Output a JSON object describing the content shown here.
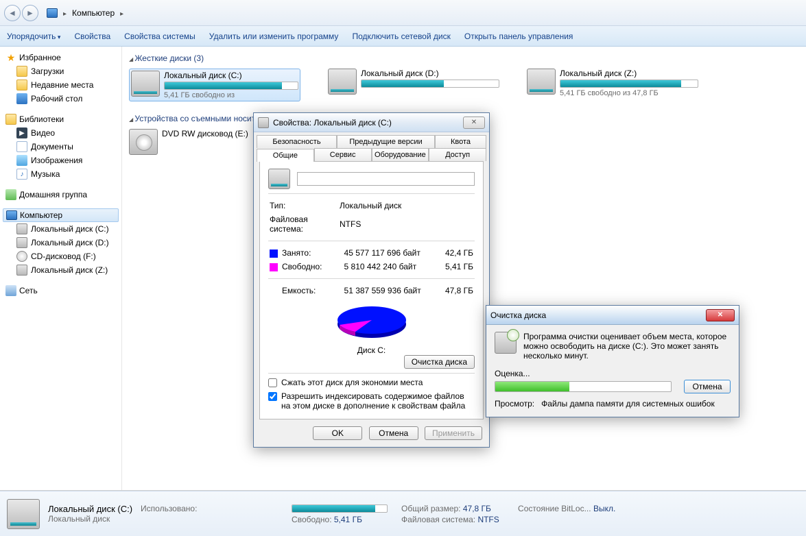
{
  "breadcrumb": {
    "root_icon": "computer",
    "item1": "Компьютер"
  },
  "toolbar": {
    "organize": "Упорядочить",
    "properties": "Свойства",
    "sysprops": "Свойства системы",
    "uninstall": "Удалить или изменить программу",
    "mapdrive": "Подключить сетевой диск",
    "controlpanel": "Открыть панель управления"
  },
  "sidebar": {
    "favorites": "Избранное",
    "downloads": "Загрузки",
    "recent": "Недавние места",
    "desktop": "Рабочий стол",
    "libraries": "Библиотеки",
    "video": "Видео",
    "documents": "Документы",
    "pictures": "Изображения",
    "music": "Музыка",
    "homegroup": "Домашняя группа",
    "computer": "Компьютер",
    "drive_c": "Локальный диск (C:)",
    "drive_d": "Локальный диск (D:)",
    "drive_f": "CD-дисковод (F:)",
    "drive_z": "Локальный диск (Z:)",
    "network": "Сеть"
  },
  "content": {
    "hd_header": "Жесткие диски (3)",
    "removable_header": "Устройства со съемными носителями",
    "drive_c": {
      "name": "Локальный диск (C:)",
      "sub": "5,41 ГБ свободно из",
      "fill": 88
    },
    "drive_d": {
      "name": "Локальный диск (D:)",
      "sub": "",
      "fill": 60
    },
    "drive_z": {
      "name": "Локальный диск (Z:)",
      "sub": "5,41 ГБ свободно из 47,8 ГБ",
      "fill": 88
    },
    "dvd": {
      "name": "DVD RW дисковод (E:)"
    }
  },
  "details": {
    "title": "Локальный диск (C:)",
    "subtitle": "Локальный диск",
    "used_k": "Использовано:",
    "total_k": "Общий размер:",
    "total_v": "47,8 ГБ",
    "free_k": "Свободно:",
    "free_v": "5,41 ГБ",
    "fs_k": "Файловая система:",
    "fs_v": "NTFS",
    "bitlocker_k": "Состояние BitLoc...",
    "bitlocker_v": "Выкл.",
    "fill": 88
  },
  "props": {
    "title": "Свойства: Локальный диск (C:)",
    "tabs_top": {
      "security": "Безопасность",
      "prev": "Предыдущие версии",
      "quota": "Квота"
    },
    "tabs_bot": {
      "general": "Общие",
      "service": "Сервис",
      "hardware": "Оборудование",
      "access": "Доступ"
    },
    "type_k": "Тип:",
    "type_v": "Локальный диск",
    "fs_k": "Файловая система:",
    "fs_v": "NTFS",
    "used_k": "Занято:",
    "used_bytes": "45 577 117 696 байт",
    "used_gb": "42,4 ГБ",
    "free_k": "Свободно:",
    "free_bytes": "5 810 442 240 байт",
    "free_gb": "5,41 ГБ",
    "cap_k": "Емкость:",
    "cap_bytes": "51 387 559 936 байт",
    "cap_gb": "47,8 ГБ",
    "disk_label": "Диск C:",
    "cleanup_btn": "Очистка диска",
    "compress": "Сжать этот диск для экономии места",
    "index": "Разрешить индексировать содержимое файлов на этом диске в дополнение к свойствам файла",
    "ok": "OK",
    "cancel": "Отмена",
    "apply": "Применить"
  },
  "cleanup": {
    "title": "Очистка диска",
    "msg": "Программа очистки оценивает объем места, которое можно освободить на диске  (C:). Это может занять несколько минут.",
    "estimating": "Оценка...",
    "cancel": "Отмена",
    "view_k": "Просмотр:",
    "view_v": "Файлы дампа памяти для системных ошибок",
    "progress": 42
  },
  "chart_data": {
    "type": "pie",
    "title": "Диск C:",
    "series": [
      {
        "name": "Занято",
        "value": 45577117696,
        "value_label": "42,4 ГБ",
        "color": "#0010ff"
      },
      {
        "name": "Свободно",
        "value": 5810442240,
        "value_label": "5,41 ГБ",
        "color": "#ff00ff"
      }
    ],
    "total": 51387559936,
    "total_label": "47,8 ГБ"
  }
}
